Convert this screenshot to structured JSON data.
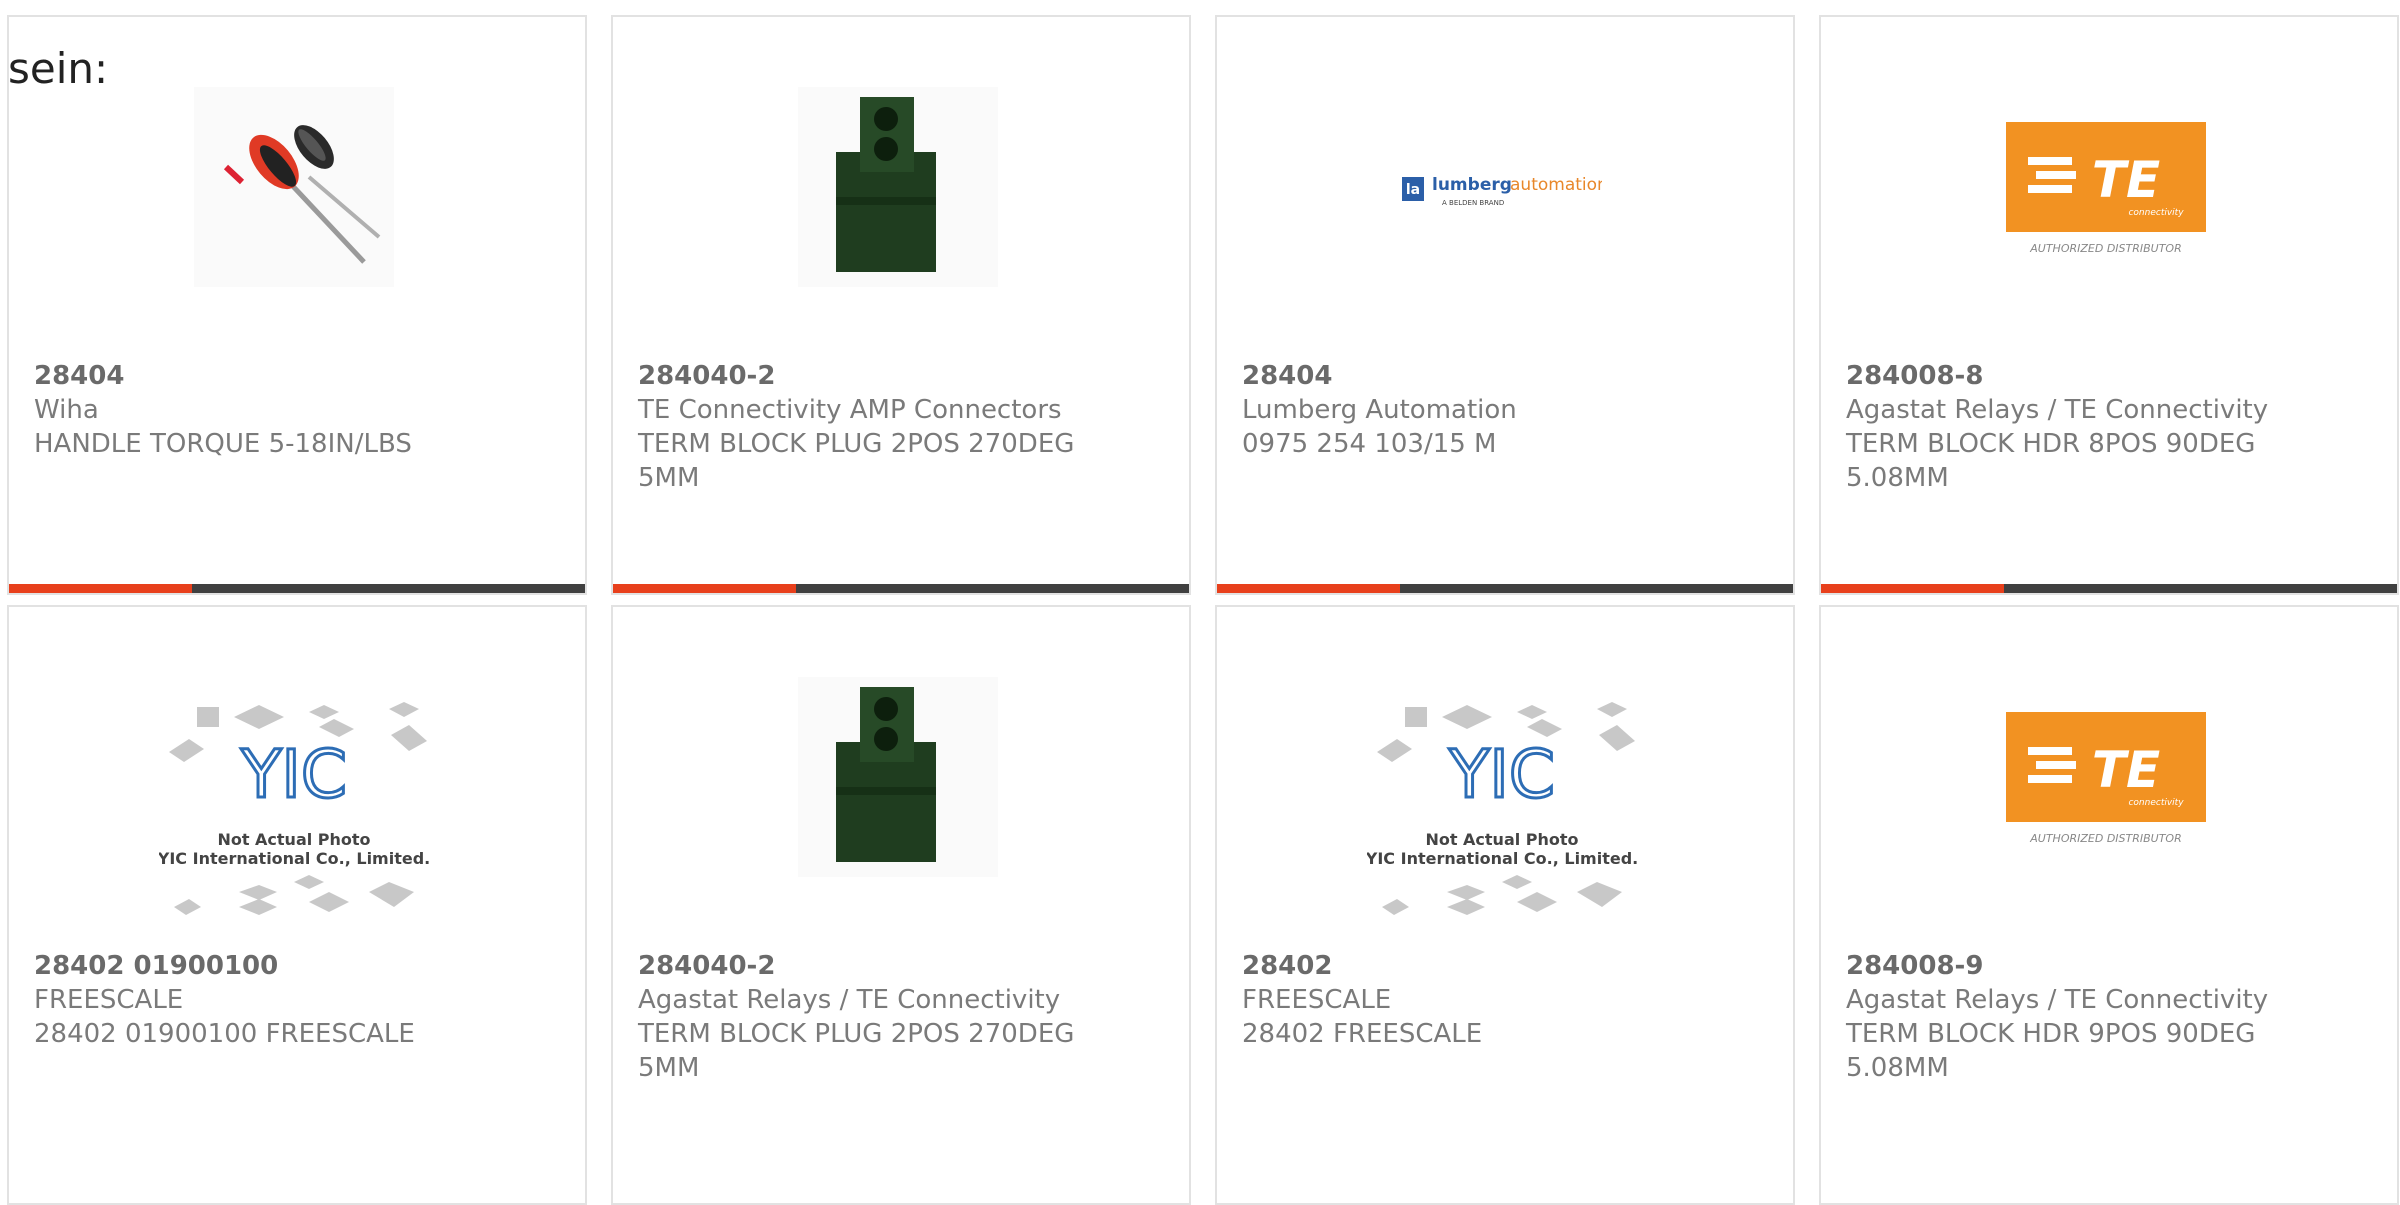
{
  "intro_text": "sein:",
  "accent_color": "#e8401c",
  "bar_color": "#404040",
  "cards": [
    {
      "part": "28404",
      "manufacturer": "Wiha",
      "description": "HANDLE TORQUE 5-18IN/LBS",
      "image": "screwdriver-photo"
    },
    {
      "part": "284040-2",
      "manufacturer": "TE Connectivity AMP Connectors",
      "description": "TERM BLOCK PLUG 2POS 270DEG 5MM",
      "image": "terminal-block-photo"
    },
    {
      "part": "28404",
      "manufacturer": "Lumberg Automation",
      "description": "0975 254 103/15 M",
      "image": "lumberg-automation-logo",
      "logo_text": {
        "brand_a": "lumberg",
        "brand_b": "automation",
        "tagline": "A BELDEN BRAND",
        "mark": "la"
      }
    },
    {
      "part": "284008-8",
      "manufacturer": "Agastat Relays / TE Connectivity",
      "description": "TERM BLOCK HDR 8POS 90DEG 5.08MM",
      "image": "te-connectivity-logo",
      "logo_text": {
        "brand": "TE",
        "sub": "connectivity",
        "caption": "AUTHORIZED DISTRIBUTOR"
      }
    },
    {
      "part": "28402 01900100",
      "manufacturer": "FREESCALE",
      "description": "28402 01900100 FREESCALE",
      "image": "yic-placeholder",
      "logo_text": {
        "line1": "Not Actual Photo",
        "line2": "YIC International Co., Limited."
      }
    },
    {
      "part": "284040-2",
      "manufacturer": "Agastat Relays / TE Connectivity",
      "description": "TERM BLOCK PLUG 2POS 270DEG 5MM",
      "image": "terminal-block-photo"
    },
    {
      "part": "28402",
      "manufacturer": "FREESCALE",
      "description": "28402 FREESCALE",
      "image": "yic-placeholder",
      "logo_text": {
        "line1": "Not Actual Photo",
        "line2": "YIC International Co., Limited."
      }
    },
    {
      "part": "284008-9",
      "manufacturer": "Agastat Relays / TE Connectivity",
      "description": "TERM BLOCK HDR 9POS 90DEG 5.08MM",
      "image": "te-connectivity-logo",
      "logo_text": {
        "brand": "TE",
        "sub": "connectivity",
        "caption": "AUTHORIZED DISTRIBUTOR"
      }
    }
  ]
}
